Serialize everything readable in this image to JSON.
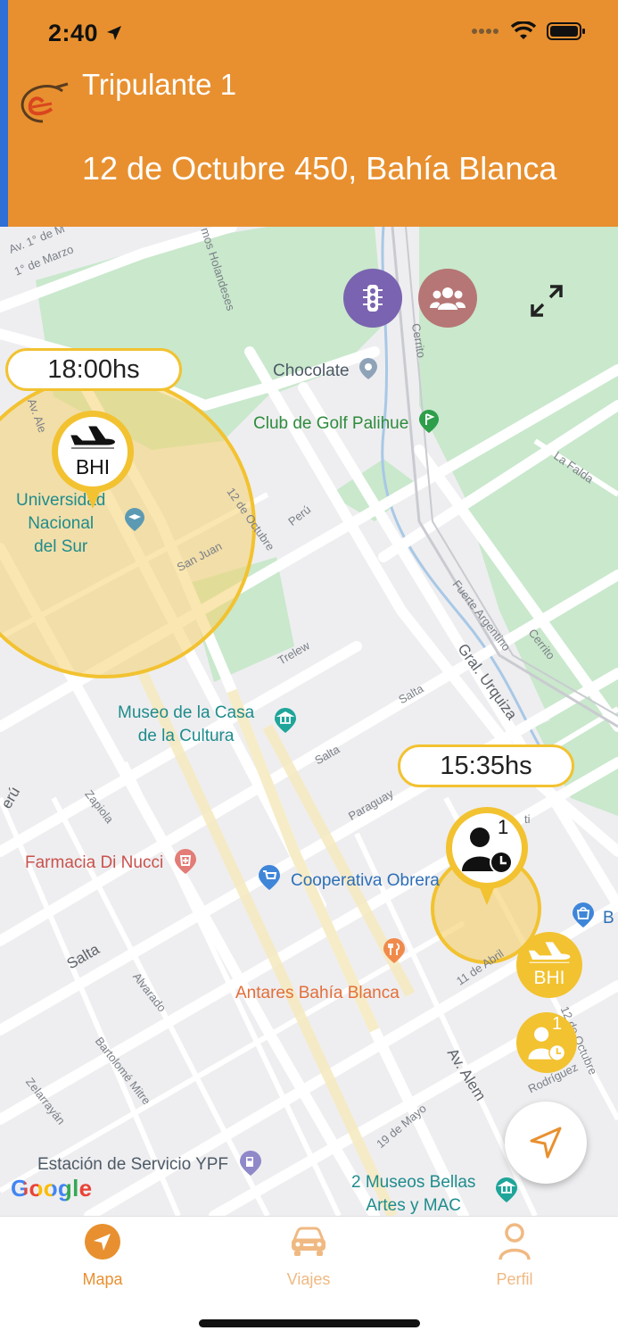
{
  "status_bar": {
    "time": "2:40"
  },
  "header": {
    "crew_label": "Tripulante 1",
    "address": "12 de Octubre 450, Bahía Blanca"
  },
  "map": {
    "controls": {
      "traffic": {
        "icon": "traffic-light-icon",
        "color": "#7A63B0"
      },
      "groups": {
        "icon": "users-icon",
        "color": "#B67675"
      },
      "fullscreen": {
        "icon": "expand-icon"
      }
    },
    "markers": [
      {
        "time": "18:00hs",
        "code": "BHI",
        "icon": "plane-icon"
      },
      {
        "time": "15:35hs",
        "count": "1",
        "icon": "user-clock-icon"
      }
    ],
    "mini_markers": [
      {
        "code": "BHI",
        "icon": "plane-icon"
      },
      {
        "count": "1",
        "icon": "user-clock-icon"
      }
    ],
    "pois": {
      "chocolate": "Chocolate",
      "golf": "Club de Golf Palihue",
      "universidad": [
        "Universidad",
        "Nacional",
        "del Sur"
      ],
      "museo": [
        "Museo de la Casa",
        "de la Cultura"
      ],
      "farmacia": "Farmacia Di Nucci",
      "cooperativa": "Cooperativa Obrera",
      "antares": "Antares Bahía Blanca",
      "ypf": "Estación de Servicio YPF",
      "museos_bellas": [
        "2 Museos Bellas",
        "Artes y MAC"
      ],
      "b_partial": "B"
    },
    "streets": {
      "av1": "Av. 1° de M",
      "marzo": "1° de Marzo",
      "holandeses": "mos Holandeses",
      "cerrito": "Cerrito",
      "av_alem_top": "Av. Ale",
      "octubre": "12 de Octubre",
      "peru": "Perú",
      "san_juan": "San Juan",
      "la_falda": "La Falda",
      "fuerte": "Fuerte Argentino",
      "cerrito2": "Cerrito",
      "urquiza": "Gral. Urquiza",
      "trelew": "Trelew",
      "salta1": "Salta",
      "salta2": "Salta",
      "paraguay": "Paraguay",
      "peru2": "erú",
      "zapiola": "Zapiola",
      "salta_big": "Salta",
      "alvarado": "Alvarado",
      "mitre": "Bartolomé Mitre",
      "zelarrayan": "Zelarrayán",
      "abril": "11 de Abril",
      "octubre2": "12 de Octubre",
      "rodriguez": "Rodríguez",
      "alem": "Av. Alem",
      "mayo": "19 de Mayo",
      "ti": "ti"
    },
    "attribution": "Google",
    "my_location": "navigation-arrow-icon"
  },
  "tabbar": {
    "tabs": [
      {
        "label": "Mapa",
        "icon": "navigation-icon",
        "active": true
      },
      {
        "label": "Viajes",
        "icon": "car-icon",
        "active": false
      },
      {
        "label": "Perfil",
        "icon": "person-icon",
        "active": false
      }
    ]
  },
  "colors": {
    "accent": "#E8902F",
    "marker_yellow": "#F2C230",
    "zone_fill": "#F5D170"
  }
}
